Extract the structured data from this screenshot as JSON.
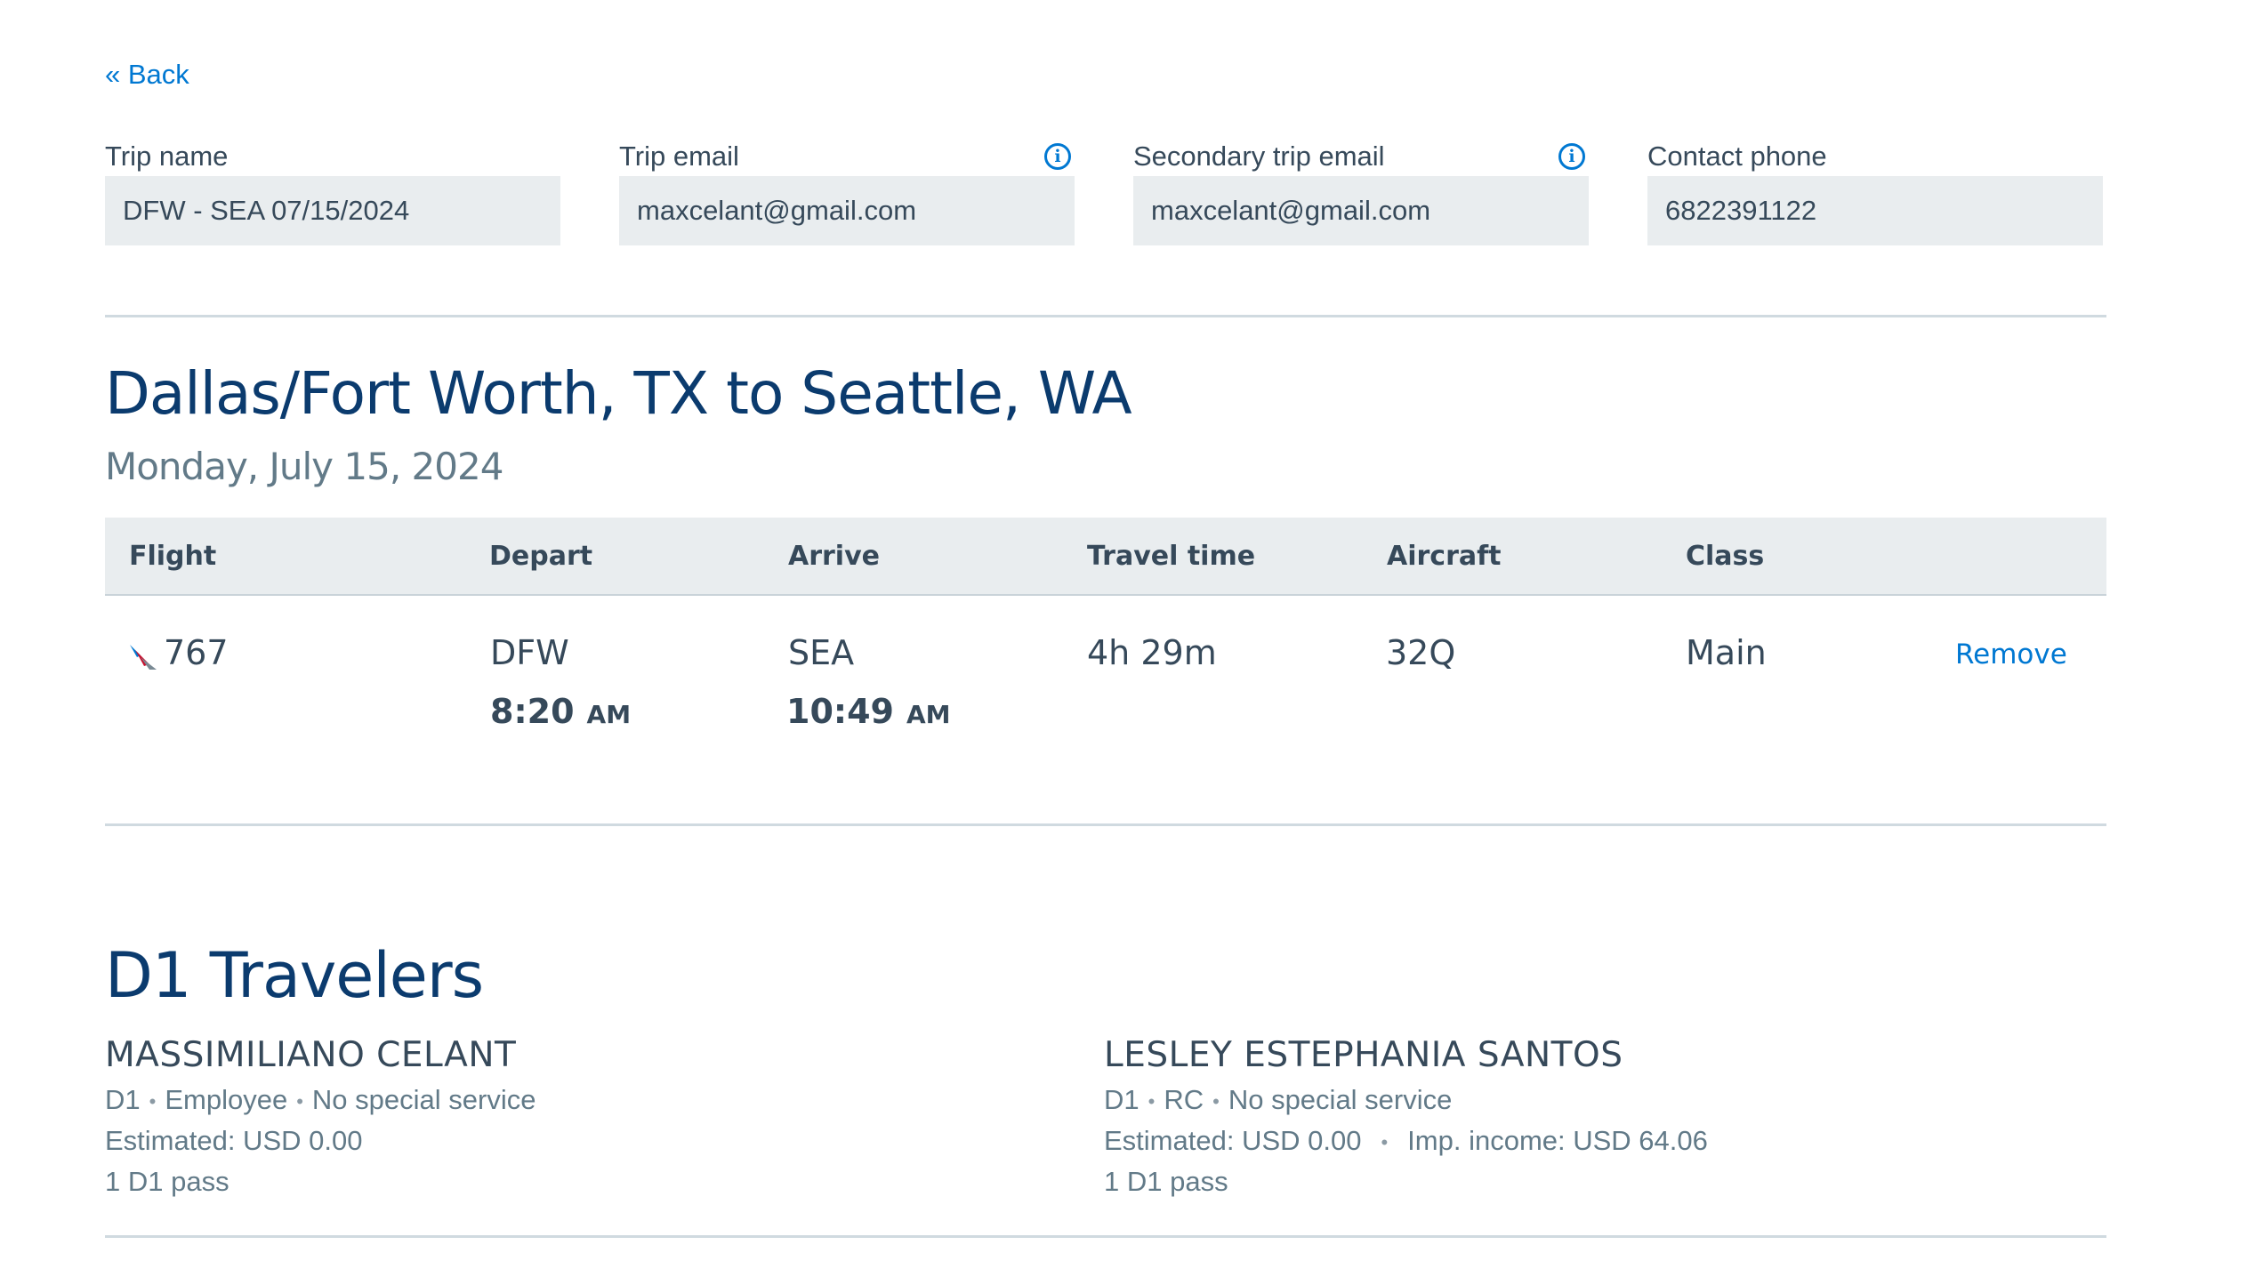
{
  "nav": {
    "back_label": "« Back"
  },
  "fields": [
    {
      "label": "Trip name",
      "value": "DFW - SEA  07/15/2024",
      "has_info": false
    },
    {
      "label": "Trip email",
      "value": "maxcelant@gmail.com",
      "has_info": true
    },
    {
      "label": "Secondary trip email",
      "value": "maxcelant@gmail.com",
      "has_info": true
    },
    {
      "label": "Contact phone",
      "value": "6822391122",
      "has_info": false
    }
  ],
  "info_icon": "info-circle-icon",
  "route": {
    "title": "Dallas/Fort Worth, TX to Seattle, WA",
    "date": "Monday, July 15, 2024"
  },
  "table": {
    "headers": {
      "flight": "Flight",
      "depart": "Depart",
      "arrive": "Arrive",
      "travel_time": "Travel time",
      "aircraft": "Aircraft",
      "class": "Class"
    },
    "row": {
      "airline_icon": "american-airlines-logo-icon",
      "flight_number": "767",
      "depart_airport": "DFW",
      "depart_time": "8:20",
      "depart_ampm": "AM",
      "arrive_airport": "SEA",
      "arrive_time": "10:49",
      "arrive_ampm": "AM",
      "travel_time": "4h 29m",
      "aircraft": "32Q",
      "class": "Main",
      "remove_label": "Remove"
    }
  },
  "travelers": {
    "title": "D1 Travelers",
    "list": [
      {
        "name": "MASSIMILIANO CELANT",
        "line1": [
          "D1",
          "Employee",
          "No special service"
        ],
        "line2": [
          "Estimated: USD 0.00"
        ],
        "line3": "1 D1 pass"
      },
      {
        "name": "LESLEY ESTEPHANIA SANTOS",
        "line1": [
          "D1",
          "RC",
          "No special service"
        ],
        "line2": [
          "Estimated: USD 0.00",
          "Imp. income: USD 64.06"
        ],
        "line3": "1 D1 pass"
      }
    ]
  },
  "colors": {
    "link": "#0078d2",
    "heading": "#0b3b6e",
    "input_bg": "#e9edef",
    "text": "#36495a",
    "muted": "#627a88"
  }
}
